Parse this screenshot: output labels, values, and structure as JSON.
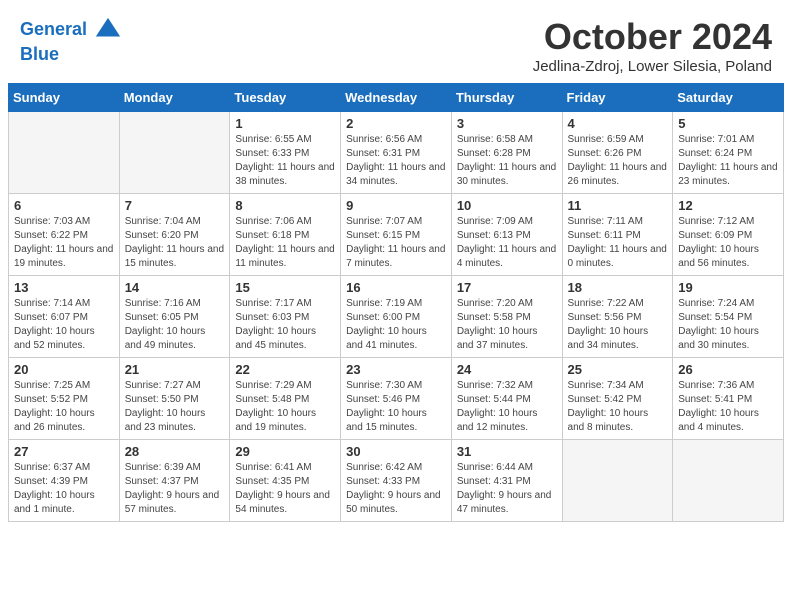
{
  "header": {
    "logo_line1": "General",
    "logo_line2": "Blue",
    "month": "October 2024",
    "location": "Jedlina-Zdroj, Lower Silesia, Poland"
  },
  "days_of_week": [
    "Sunday",
    "Monday",
    "Tuesday",
    "Wednesday",
    "Thursday",
    "Friday",
    "Saturday"
  ],
  "weeks": [
    [
      {
        "day": "",
        "empty": true
      },
      {
        "day": "",
        "empty": true
      },
      {
        "day": "1",
        "sunrise": "Sunrise: 6:55 AM",
        "sunset": "Sunset: 6:33 PM",
        "daylight": "Daylight: 11 hours and 38 minutes."
      },
      {
        "day": "2",
        "sunrise": "Sunrise: 6:56 AM",
        "sunset": "Sunset: 6:31 PM",
        "daylight": "Daylight: 11 hours and 34 minutes."
      },
      {
        "day": "3",
        "sunrise": "Sunrise: 6:58 AM",
        "sunset": "Sunset: 6:28 PM",
        "daylight": "Daylight: 11 hours and 30 minutes."
      },
      {
        "day": "4",
        "sunrise": "Sunrise: 6:59 AM",
        "sunset": "Sunset: 6:26 PM",
        "daylight": "Daylight: 11 hours and 26 minutes."
      },
      {
        "day": "5",
        "sunrise": "Sunrise: 7:01 AM",
        "sunset": "Sunset: 6:24 PM",
        "daylight": "Daylight: 11 hours and 23 minutes."
      }
    ],
    [
      {
        "day": "6",
        "sunrise": "Sunrise: 7:03 AM",
        "sunset": "Sunset: 6:22 PM",
        "daylight": "Daylight: 11 hours and 19 minutes."
      },
      {
        "day": "7",
        "sunrise": "Sunrise: 7:04 AM",
        "sunset": "Sunset: 6:20 PM",
        "daylight": "Daylight: 11 hours and 15 minutes."
      },
      {
        "day": "8",
        "sunrise": "Sunrise: 7:06 AM",
        "sunset": "Sunset: 6:18 PM",
        "daylight": "Daylight: 11 hours and 11 minutes."
      },
      {
        "day": "9",
        "sunrise": "Sunrise: 7:07 AM",
        "sunset": "Sunset: 6:15 PM",
        "daylight": "Daylight: 11 hours and 7 minutes."
      },
      {
        "day": "10",
        "sunrise": "Sunrise: 7:09 AM",
        "sunset": "Sunset: 6:13 PM",
        "daylight": "Daylight: 11 hours and 4 minutes."
      },
      {
        "day": "11",
        "sunrise": "Sunrise: 7:11 AM",
        "sunset": "Sunset: 6:11 PM",
        "daylight": "Daylight: 11 hours and 0 minutes."
      },
      {
        "day": "12",
        "sunrise": "Sunrise: 7:12 AM",
        "sunset": "Sunset: 6:09 PM",
        "daylight": "Daylight: 10 hours and 56 minutes."
      }
    ],
    [
      {
        "day": "13",
        "sunrise": "Sunrise: 7:14 AM",
        "sunset": "Sunset: 6:07 PM",
        "daylight": "Daylight: 10 hours and 52 minutes."
      },
      {
        "day": "14",
        "sunrise": "Sunrise: 7:16 AM",
        "sunset": "Sunset: 6:05 PM",
        "daylight": "Daylight: 10 hours and 49 minutes."
      },
      {
        "day": "15",
        "sunrise": "Sunrise: 7:17 AM",
        "sunset": "Sunset: 6:03 PM",
        "daylight": "Daylight: 10 hours and 45 minutes."
      },
      {
        "day": "16",
        "sunrise": "Sunrise: 7:19 AM",
        "sunset": "Sunset: 6:00 PM",
        "daylight": "Daylight: 10 hours and 41 minutes."
      },
      {
        "day": "17",
        "sunrise": "Sunrise: 7:20 AM",
        "sunset": "Sunset: 5:58 PM",
        "daylight": "Daylight: 10 hours and 37 minutes."
      },
      {
        "day": "18",
        "sunrise": "Sunrise: 7:22 AM",
        "sunset": "Sunset: 5:56 PM",
        "daylight": "Daylight: 10 hours and 34 minutes."
      },
      {
        "day": "19",
        "sunrise": "Sunrise: 7:24 AM",
        "sunset": "Sunset: 5:54 PM",
        "daylight": "Daylight: 10 hours and 30 minutes."
      }
    ],
    [
      {
        "day": "20",
        "sunrise": "Sunrise: 7:25 AM",
        "sunset": "Sunset: 5:52 PM",
        "daylight": "Daylight: 10 hours and 26 minutes."
      },
      {
        "day": "21",
        "sunrise": "Sunrise: 7:27 AM",
        "sunset": "Sunset: 5:50 PM",
        "daylight": "Daylight: 10 hours and 23 minutes."
      },
      {
        "day": "22",
        "sunrise": "Sunrise: 7:29 AM",
        "sunset": "Sunset: 5:48 PM",
        "daylight": "Daylight: 10 hours and 19 minutes."
      },
      {
        "day": "23",
        "sunrise": "Sunrise: 7:30 AM",
        "sunset": "Sunset: 5:46 PM",
        "daylight": "Daylight: 10 hours and 15 minutes."
      },
      {
        "day": "24",
        "sunrise": "Sunrise: 7:32 AM",
        "sunset": "Sunset: 5:44 PM",
        "daylight": "Daylight: 10 hours and 12 minutes."
      },
      {
        "day": "25",
        "sunrise": "Sunrise: 7:34 AM",
        "sunset": "Sunset: 5:42 PM",
        "daylight": "Daylight: 10 hours and 8 minutes."
      },
      {
        "day": "26",
        "sunrise": "Sunrise: 7:36 AM",
        "sunset": "Sunset: 5:41 PM",
        "daylight": "Daylight: 10 hours and 4 minutes."
      }
    ],
    [
      {
        "day": "27",
        "sunrise": "Sunrise: 6:37 AM",
        "sunset": "Sunset: 4:39 PM",
        "daylight": "Daylight: 10 hours and 1 minute."
      },
      {
        "day": "28",
        "sunrise": "Sunrise: 6:39 AM",
        "sunset": "Sunset: 4:37 PM",
        "daylight": "Daylight: 9 hours and 57 minutes."
      },
      {
        "day": "29",
        "sunrise": "Sunrise: 6:41 AM",
        "sunset": "Sunset: 4:35 PM",
        "daylight": "Daylight: 9 hours and 54 minutes."
      },
      {
        "day": "30",
        "sunrise": "Sunrise: 6:42 AM",
        "sunset": "Sunset: 4:33 PM",
        "daylight": "Daylight: 9 hours and 50 minutes."
      },
      {
        "day": "31",
        "sunrise": "Sunrise: 6:44 AM",
        "sunset": "Sunset: 4:31 PM",
        "daylight": "Daylight: 9 hours and 47 minutes."
      },
      {
        "day": "",
        "empty": true
      },
      {
        "day": "",
        "empty": true
      }
    ]
  ]
}
